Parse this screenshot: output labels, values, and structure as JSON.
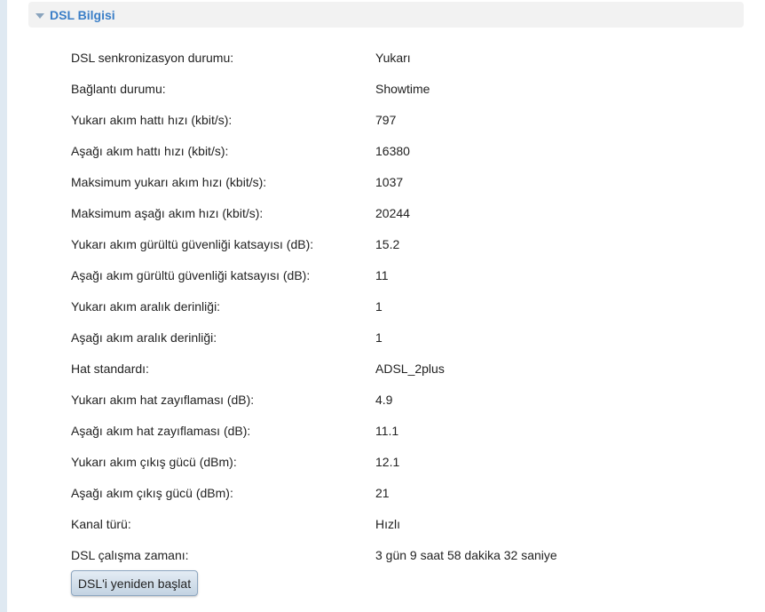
{
  "section": {
    "title": "DSL Bilgisi"
  },
  "rows": [
    {
      "label": "DSL senkronizasyon durumu:",
      "value": "Yukarı"
    },
    {
      "label": "Bağlantı durumu:",
      "value": "Showtime"
    },
    {
      "label": "Yukarı akım hattı hızı (kbit/s):",
      "value": "797"
    },
    {
      "label": "Aşağı akım hattı hızı (kbit/s):",
      "value": "16380"
    },
    {
      "label": "Maksimum yukarı akım hızı (kbit/s):",
      "value": "1037"
    },
    {
      "label": "Maksimum aşağı akım hızı (kbit/s):",
      "value": "20244"
    },
    {
      "label": "Yukarı akım gürültü güvenliği katsayısı (dB):",
      "value": "15.2"
    },
    {
      "label": "Aşağı akım gürültü güvenliği katsayısı (dB):",
      "value": "11"
    },
    {
      "label": "Yukarı akım aralık derinliği:",
      "value": "1"
    },
    {
      "label": "Aşağı akım aralık derinliği:",
      "value": "1"
    },
    {
      "label": "Hat standardı:",
      "value": "ADSL_2plus"
    },
    {
      "label": "Yukarı akım hat zayıflaması (dB):",
      "value": "4.9"
    },
    {
      "label": "Aşağı akım hat zayıflaması (dB):",
      "value": "11.1"
    },
    {
      "label": "Yukarı akım çıkış gücü (dBm):",
      "value": "12.1"
    },
    {
      "label": "Aşağı akım çıkış gücü (dBm):",
      "value": "21"
    },
    {
      "label": "Kanal türü:",
      "value": "Hızlı"
    },
    {
      "label": "DSL çalışma zamanı:",
      "value": "3 gün 9 saat 58 dakika 32 saniye"
    }
  ],
  "actions": {
    "restart_label": "DSL'i yeniden başlat"
  },
  "colors": {
    "title": "#3a7ec7",
    "header_bg": "#f2f2f2",
    "button_border": "#8da6c0"
  }
}
